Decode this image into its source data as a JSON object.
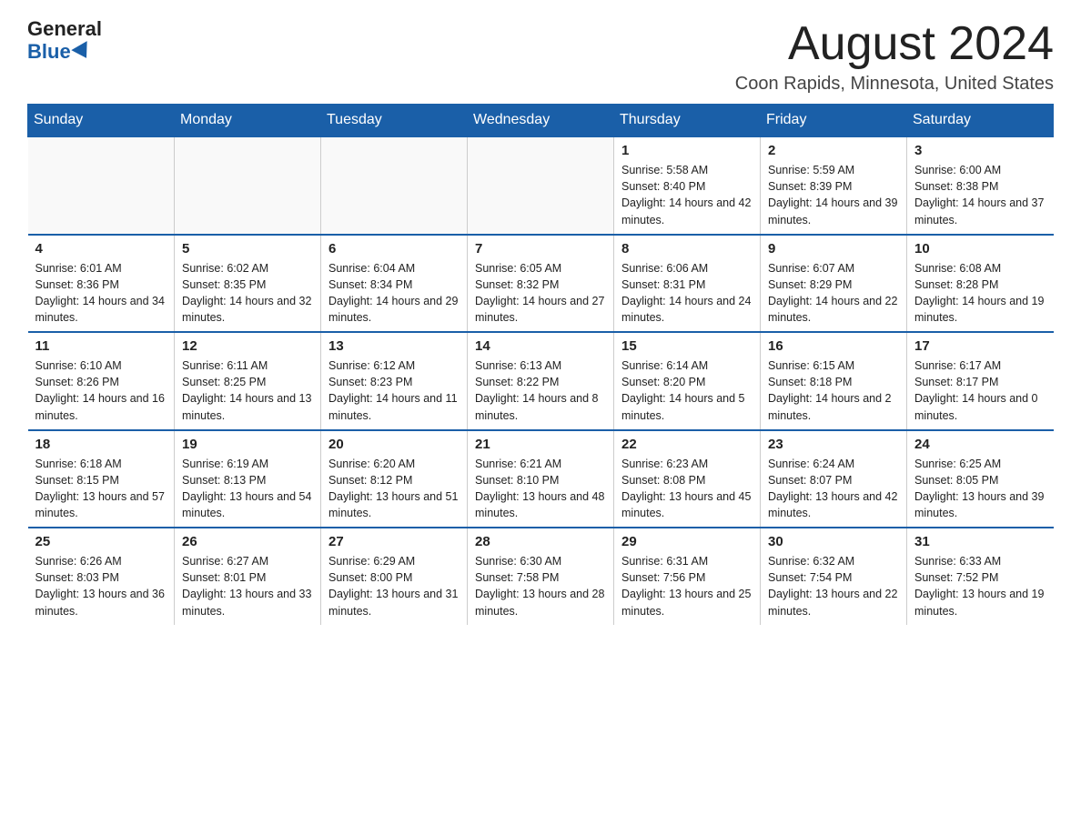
{
  "logo": {
    "general": "General",
    "blue": "Blue"
  },
  "title": {
    "month": "August 2024",
    "location": "Coon Rapids, Minnesota, United States"
  },
  "weekdays": [
    "Sunday",
    "Monday",
    "Tuesday",
    "Wednesday",
    "Thursday",
    "Friday",
    "Saturday"
  ],
  "weeks": [
    [
      {
        "day": "",
        "info": ""
      },
      {
        "day": "",
        "info": ""
      },
      {
        "day": "",
        "info": ""
      },
      {
        "day": "",
        "info": ""
      },
      {
        "day": "1",
        "info": "Sunrise: 5:58 AM\nSunset: 8:40 PM\nDaylight: 14 hours and 42 minutes."
      },
      {
        "day": "2",
        "info": "Sunrise: 5:59 AM\nSunset: 8:39 PM\nDaylight: 14 hours and 39 minutes."
      },
      {
        "day": "3",
        "info": "Sunrise: 6:00 AM\nSunset: 8:38 PM\nDaylight: 14 hours and 37 minutes."
      }
    ],
    [
      {
        "day": "4",
        "info": "Sunrise: 6:01 AM\nSunset: 8:36 PM\nDaylight: 14 hours and 34 minutes."
      },
      {
        "day": "5",
        "info": "Sunrise: 6:02 AM\nSunset: 8:35 PM\nDaylight: 14 hours and 32 minutes."
      },
      {
        "day": "6",
        "info": "Sunrise: 6:04 AM\nSunset: 8:34 PM\nDaylight: 14 hours and 29 minutes."
      },
      {
        "day": "7",
        "info": "Sunrise: 6:05 AM\nSunset: 8:32 PM\nDaylight: 14 hours and 27 minutes."
      },
      {
        "day": "8",
        "info": "Sunrise: 6:06 AM\nSunset: 8:31 PM\nDaylight: 14 hours and 24 minutes."
      },
      {
        "day": "9",
        "info": "Sunrise: 6:07 AM\nSunset: 8:29 PM\nDaylight: 14 hours and 22 minutes."
      },
      {
        "day": "10",
        "info": "Sunrise: 6:08 AM\nSunset: 8:28 PM\nDaylight: 14 hours and 19 minutes."
      }
    ],
    [
      {
        "day": "11",
        "info": "Sunrise: 6:10 AM\nSunset: 8:26 PM\nDaylight: 14 hours and 16 minutes."
      },
      {
        "day": "12",
        "info": "Sunrise: 6:11 AM\nSunset: 8:25 PM\nDaylight: 14 hours and 13 minutes."
      },
      {
        "day": "13",
        "info": "Sunrise: 6:12 AM\nSunset: 8:23 PM\nDaylight: 14 hours and 11 minutes."
      },
      {
        "day": "14",
        "info": "Sunrise: 6:13 AM\nSunset: 8:22 PM\nDaylight: 14 hours and 8 minutes."
      },
      {
        "day": "15",
        "info": "Sunrise: 6:14 AM\nSunset: 8:20 PM\nDaylight: 14 hours and 5 minutes."
      },
      {
        "day": "16",
        "info": "Sunrise: 6:15 AM\nSunset: 8:18 PM\nDaylight: 14 hours and 2 minutes."
      },
      {
        "day": "17",
        "info": "Sunrise: 6:17 AM\nSunset: 8:17 PM\nDaylight: 14 hours and 0 minutes."
      }
    ],
    [
      {
        "day": "18",
        "info": "Sunrise: 6:18 AM\nSunset: 8:15 PM\nDaylight: 13 hours and 57 minutes."
      },
      {
        "day": "19",
        "info": "Sunrise: 6:19 AM\nSunset: 8:13 PM\nDaylight: 13 hours and 54 minutes."
      },
      {
        "day": "20",
        "info": "Sunrise: 6:20 AM\nSunset: 8:12 PM\nDaylight: 13 hours and 51 minutes."
      },
      {
        "day": "21",
        "info": "Sunrise: 6:21 AM\nSunset: 8:10 PM\nDaylight: 13 hours and 48 minutes."
      },
      {
        "day": "22",
        "info": "Sunrise: 6:23 AM\nSunset: 8:08 PM\nDaylight: 13 hours and 45 minutes."
      },
      {
        "day": "23",
        "info": "Sunrise: 6:24 AM\nSunset: 8:07 PM\nDaylight: 13 hours and 42 minutes."
      },
      {
        "day": "24",
        "info": "Sunrise: 6:25 AM\nSunset: 8:05 PM\nDaylight: 13 hours and 39 minutes."
      }
    ],
    [
      {
        "day": "25",
        "info": "Sunrise: 6:26 AM\nSunset: 8:03 PM\nDaylight: 13 hours and 36 minutes."
      },
      {
        "day": "26",
        "info": "Sunrise: 6:27 AM\nSunset: 8:01 PM\nDaylight: 13 hours and 33 minutes."
      },
      {
        "day": "27",
        "info": "Sunrise: 6:29 AM\nSunset: 8:00 PM\nDaylight: 13 hours and 31 minutes."
      },
      {
        "day": "28",
        "info": "Sunrise: 6:30 AM\nSunset: 7:58 PM\nDaylight: 13 hours and 28 minutes."
      },
      {
        "day": "29",
        "info": "Sunrise: 6:31 AM\nSunset: 7:56 PM\nDaylight: 13 hours and 25 minutes."
      },
      {
        "day": "30",
        "info": "Sunrise: 6:32 AM\nSunset: 7:54 PM\nDaylight: 13 hours and 22 minutes."
      },
      {
        "day": "31",
        "info": "Sunrise: 6:33 AM\nSunset: 7:52 PM\nDaylight: 13 hours and 19 minutes."
      }
    ]
  ]
}
